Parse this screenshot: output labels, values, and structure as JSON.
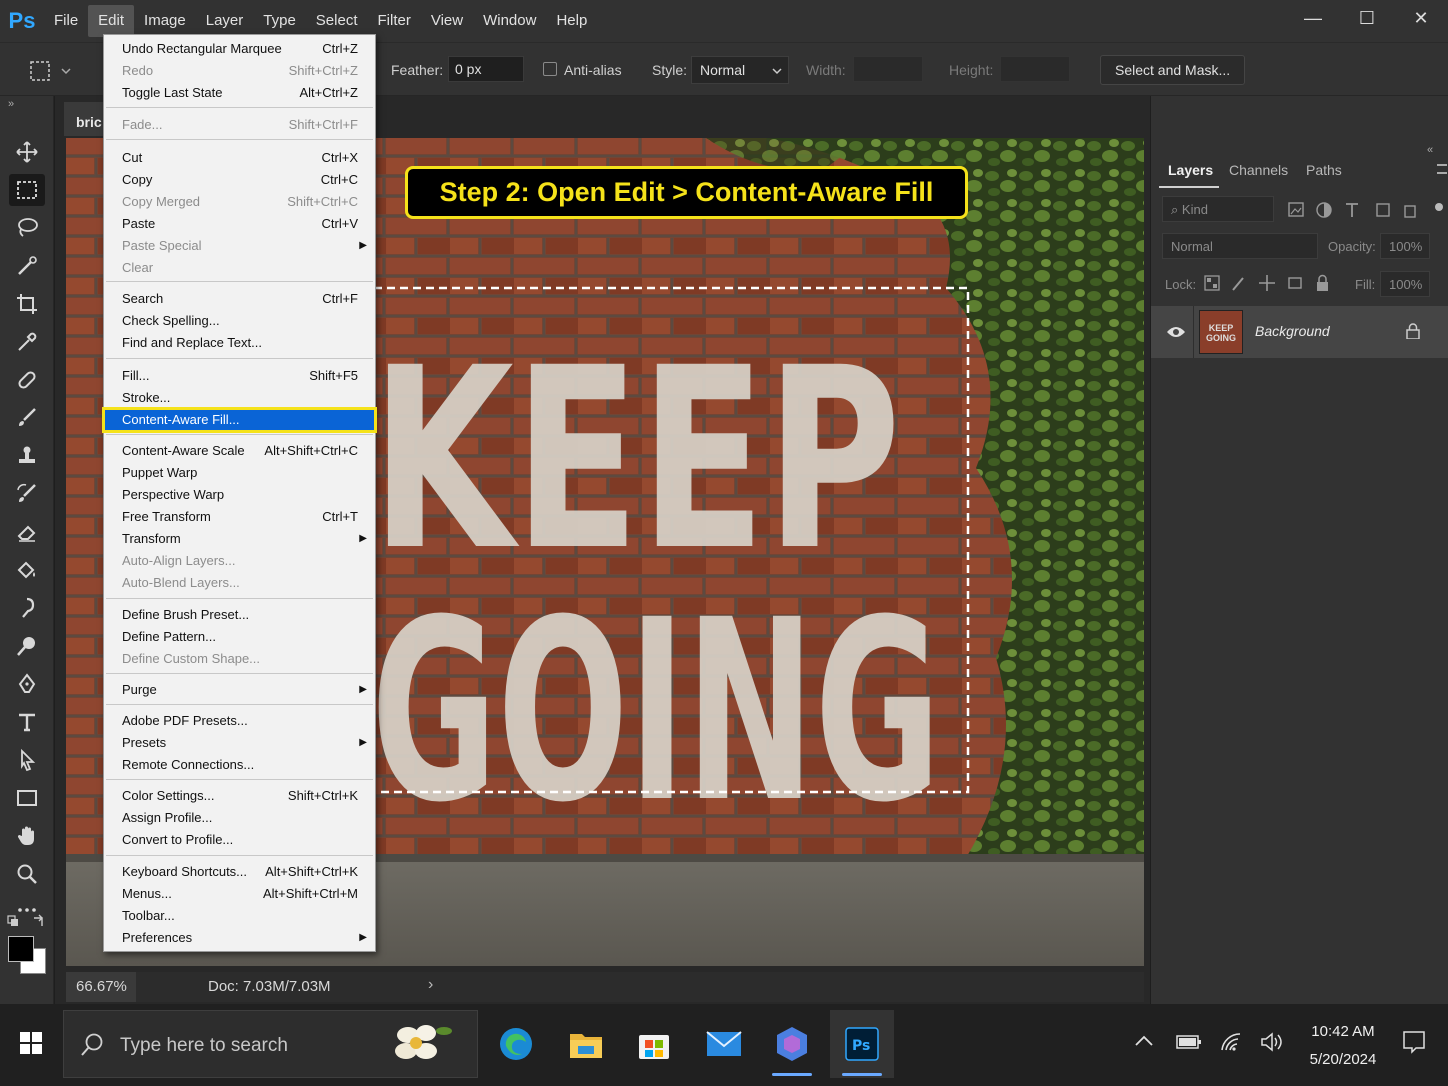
{
  "app": {
    "logo": "Ps"
  },
  "menubar": {
    "items": [
      "File",
      "Edit",
      "Image",
      "Layer",
      "Type",
      "Select",
      "Filter",
      "View",
      "Window",
      "Help"
    ],
    "active": "Edit"
  },
  "window_controls": {
    "minimize": "—",
    "maximize": "☐",
    "close": "✕"
  },
  "options": {
    "feather_label": "Feather:",
    "feather_value": "0 px",
    "antialias_label": "Anti-alias",
    "style_label": "Style:",
    "style_value": "Normal",
    "width_label": "Width:",
    "height_label": "Height:",
    "select_mask": "Select and Mask..."
  },
  "document": {
    "tab_title": "bric",
    "callout": "Step 2: Open Edit > Content-Aware Fill",
    "zoom": "66.67%",
    "doc_info": "Doc: 7.03M/7.03M",
    "art_line1": "KEEP",
    "art_line2": "GOING"
  },
  "edit_menu": [
    {
      "label": "Undo Rectangular Marquee",
      "shortcut": "Ctrl+Z",
      "disabled": false
    },
    {
      "label": "Redo",
      "shortcut": "Shift+Ctrl+Z",
      "disabled": true
    },
    {
      "label": "Toggle Last State",
      "shortcut": "Alt+Ctrl+Z",
      "disabled": false
    },
    {
      "label": "Fade...",
      "shortcut": "Shift+Ctrl+F",
      "disabled": true
    },
    {
      "label": "Cut",
      "shortcut": "Ctrl+X",
      "disabled": false
    },
    {
      "label": "Copy",
      "shortcut": "Ctrl+C",
      "disabled": false
    },
    {
      "label": "Copy Merged",
      "shortcut": "Shift+Ctrl+C",
      "disabled": true
    },
    {
      "label": "Paste",
      "shortcut": "Ctrl+V",
      "disabled": false
    },
    {
      "label": "Paste Special",
      "shortcut": "",
      "disabled": true
    },
    {
      "label": "Clear",
      "shortcut": "",
      "disabled": true
    },
    {
      "label": "Search",
      "shortcut": "Ctrl+F",
      "disabled": false
    },
    {
      "label": "Check Spelling...",
      "shortcut": "",
      "disabled": false
    },
    {
      "label": "Find and Replace Text...",
      "shortcut": "",
      "disabled": false
    },
    {
      "label": "Fill...",
      "shortcut": "Shift+F5",
      "disabled": false
    },
    {
      "label": "Stroke...",
      "shortcut": "",
      "disabled": false
    },
    {
      "label": "Content-Aware Fill...",
      "shortcut": "",
      "disabled": false
    },
    {
      "label": "Content-Aware Scale",
      "shortcut": "Alt+Shift+Ctrl+C",
      "disabled": false
    },
    {
      "label": "Puppet Warp",
      "shortcut": "",
      "disabled": false
    },
    {
      "label": "Perspective Warp",
      "shortcut": "",
      "disabled": false
    },
    {
      "label": "Free Transform",
      "shortcut": "Ctrl+T",
      "disabled": false
    },
    {
      "label": "Transform",
      "shortcut": "",
      "disabled": false
    },
    {
      "label": "Auto-Align Layers...",
      "shortcut": "",
      "disabled": true
    },
    {
      "label": "Auto-Blend Layers...",
      "shortcut": "",
      "disabled": true
    },
    {
      "label": "Define Brush Preset...",
      "shortcut": "",
      "disabled": false
    },
    {
      "label": "Define Pattern...",
      "shortcut": "",
      "disabled": false
    },
    {
      "label": "Define Custom Shape...",
      "shortcut": "",
      "disabled": true
    },
    {
      "label": "Purge",
      "shortcut": "",
      "disabled": false
    },
    {
      "label": "Adobe PDF Presets...",
      "shortcut": "",
      "disabled": false
    },
    {
      "label": "Presets",
      "shortcut": "",
      "disabled": false
    },
    {
      "label": "Remote Connections...",
      "shortcut": "",
      "disabled": false
    },
    {
      "label": "Color Settings...",
      "shortcut": "Shift+Ctrl+K",
      "disabled": false
    },
    {
      "label": "Assign Profile...",
      "shortcut": "",
      "disabled": false
    },
    {
      "label": "Convert to Profile...",
      "shortcut": "",
      "disabled": false
    },
    {
      "label": "Keyboard Shortcuts...",
      "shortcut": "Alt+Shift+Ctrl+K",
      "disabled": false
    },
    {
      "label": "Menus...",
      "shortcut": "Alt+Shift+Ctrl+M",
      "disabled": false
    },
    {
      "label": "Toolbar...",
      "shortcut": "",
      "disabled": false
    },
    {
      "label": "Preferences",
      "shortcut": "",
      "disabled": false
    }
  ],
  "layers": {
    "tabs": [
      "Layers",
      "Channels",
      "Paths"
    ],
    "kind": "Kind",
    "blend": "Normal",
    "opacity_label": "Opacity:",
    "opacity_value": "100%",
    "lock_label": "Lock:",
    "fill_label": "Fill:",
    "fill_value": "100%",
    "layer_name": "Background",
    "thumb_line1": "KEEP",
    "thumb_line2": "GOING"
  },
  "taskbar": {
    "search_placeholder": "Type here to search",
    "time": "10:42 AM",
    "date": "5/20/2024"
  },
  "colors": {
    "accent": "#31a8ff",
    "highlight": "#0a64d6",
    "callout_border": "#f5e21a",
    "brick": "#8a3e2a"
  }
}
